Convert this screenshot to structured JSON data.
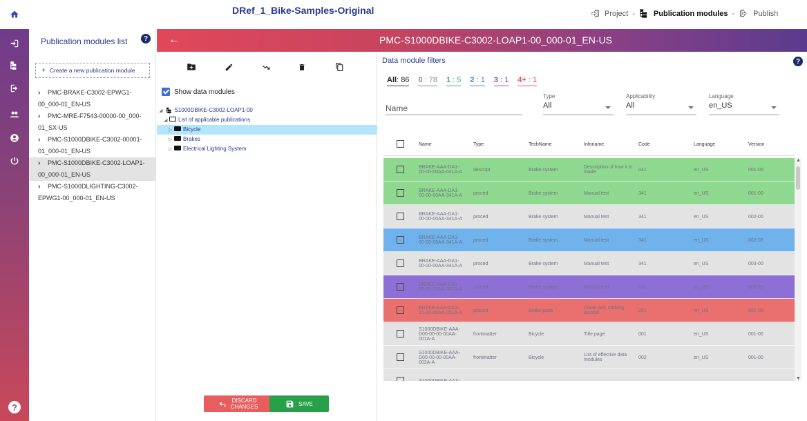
{
  "app": {
    "title": "DRef_1_Bike-Samples-Original"
  },
  "breadcrumbs": [
    {
      "label": "Project",
      "active": false
    },
    {
      "label": "Publication modules",
      "active": true
    },
    {
      "label": "Publish",
      "active": false
    }
  ],
  "rail": {
    "icons": [
      "home-icon",
      "login-icon",
      "tree-icon",
      "logout-icon",
      "users-icon",
      "account-icon",
      "power-icon",
      "help-icon"
    ]
  },
  "left_panel": {
    "title": "Publication modules list",
    "help": "?",
    "create_label": "Create a new publication module",
    "items": [
      {
        "label": "PMC-BRAKE-C3002-EPWG1-00_000-01_EN-US",
        "selected": false
      },
      {
        "label": "PMC-MRE-F7543-00000-00_000-01_SX-US",
        "selected": false
      },
      {
        "label": "PMC-S1000DBIKE-C3002-00001-01_000-01_EN-US",
        "selected": false
      },
      {
        "label": "PMC-S1000DBIKE-C3002-LOAP1-00_000-01_EN-US",
        "selected": true
      },
      {
        "label": "PMC-S1000DLIGHTING-C3002-EPWG1-00_000-01_EN-US",
        "selected": false
      }
    ]
  },
  "header": {
    "pmc": "PMC-S1000DBIKE-C3002-LOAP1-00_000-01_EN-US"
  },
  "middle": {
    "toolbar": [
      "new-folder-icon",
      "edit-icon",
      "route-icon",
      "delete-icon",
      "copy-icon"
    ],
    "show_dm_label": "Show data modules",
    "show_dm_checked": true,
    "tree": {
      "root": "S1000DBIKE-C3002-LOAP1-00",
      "list": "List of applicable publications",
      "children": [
        "Bicycle",
        "Brakes",
        "Electrical Lighting System"
      ],
      "selected": "Bicycle"
    },
    "discard_label_1": "DISCARD",
    "discard_label_2": "CHANGES",
    "save_label": "SAVE"
  },
  "filters": {
    "title": "Data module filters",
    "help": "?",
    "tabs": [
      {
        "key": "All",
        "count": "86",
        "color": "#333333"
      },
      {
        "key": "0",
        "count": "78",
        "color": "#8a8a8a"
      },
      {
        "key": "1",
        "count": "5",
        "color": "#3cb371"
      },
      {
        "key": "2",
        "count": "1",
        "color": "#3a8fd6"
      },
      {
        "key": "3",
        "count": "1",
        "color": "#7c4fcf"
      },
      {
        "key": "4+",
        "count": "1",
        "color": "#e05555"
      }
    ],
    "name_placeholder": "Name",
    "type": {
      "label": "Type",
      "value": "All"
    },
    "applicability": {
      "label": "Applicability",
      "value": "All"
    },
    "language": {
      "label": "Language",
      "value": "en_US"
    }
  },
  "table": {
    "columns": [
      "Name",
      "Type",
      "TechName",
      "Infoname",
      "Code",
      "Language",
      "Version"
    ],
    "rows": [
      {
        "name": "BRAKE-AAA-DA1-00-00-00AA-041A-A",
        "type": "descript",
        "tech": "Brake system",
        "info": "Description of how it is made",
        "code": "041",
        "lang": "en_US",
        "ver": "001-00",
        "bg": "#8fd88f"
      },
      {
        "name": "BRAKE-AAA-DA1-00-00-00AA-341A-A",
        "type": "proced",
        "tech": "Brake system",
        "info": "Manual test",
        "code": "341",
        "lang": "en_US",
        "ver": "001-00",
        "bg": "#8fd88f"
      },
      {
        "name": "BRAKE-AAA-DA1-00-00-00AA-341A-A",
        "type": "proced",
        "tech": "Brake system",
        "info": "Manual test",
        "code": "341",
        "lang": "en_US",
        "ver": "002-00",
        "bg": "#e3e3e3"
      },
      {
        "name": "BRAKE-AAA-DA1-00-00-00AA-341A-A",
        "type": "proced",
        "tech": "Brake system",
        "info": "Manual test",
        "code": "341",
        "lang": "en_US",
        "ver": "002-02",
        "bg": "#6fb2ec"
      },
      {
        "name": "BRAKE-AAA-DA1-00-00-00AA-341A-A",
        "type": "proced",
        "tech": "Brake system",
        "info": "Manual test",
        "code": "341",
        "lang": "en_US",
        "ver": "003-00",
        "bg": "#e3e3e3"
      },
      {
        "name": "BRAKE-AAA-DA1-00-00-00AA-341A-A",
        "type": "proced",
        "tech": "Brake system",
        "info": "Manual test",
        "code": "341",
        "lang": "en_US",
        "ver": "003-03",
        "bg": "#8d6fd6"
      },
      {
        "name": "BRAKE-AAA-DA1-10-00-00AA-251A-A",
        "type": "proced",
        "tech": "Brake pads",
        "info": "Clean with rubbing alcohol",
        "code": "251",
        "lang": "en_US",
        "ver": "001-00",
        "bg": "#ea6f6f"
      },
      {
        "name": "S1000DBIKE-AAA-D00-00-00-00AA-001A-A",
        "type": "frontmatter",
        "tech": "Bicycle",
        "info": "Title page",
        "code": "001",
        "lang": "en_US",
        "ver": "001-00",
        "bg": "#e3e3e3"
      },
      {
        "name": "S1000DBIKE-AAA-D00-00-00-00AA-002A-A",
        "type": "frontmatter",
        "tech": "Bicycle",
        "info": "List of effective data modules",
        "code": "002",
        "lang": "en_US",
        "ver": "001-00",
        "bg": "#e3e3e3"
      },
      {
        "name": "S1000DBIKE-AAA-",
        "type": "",
        "tech": "",
        "info": "",
        "code": "",
        "lang": "",
        "ver": "",
        "bg": "#e3e3e3"
      }
    ]
  }
}
